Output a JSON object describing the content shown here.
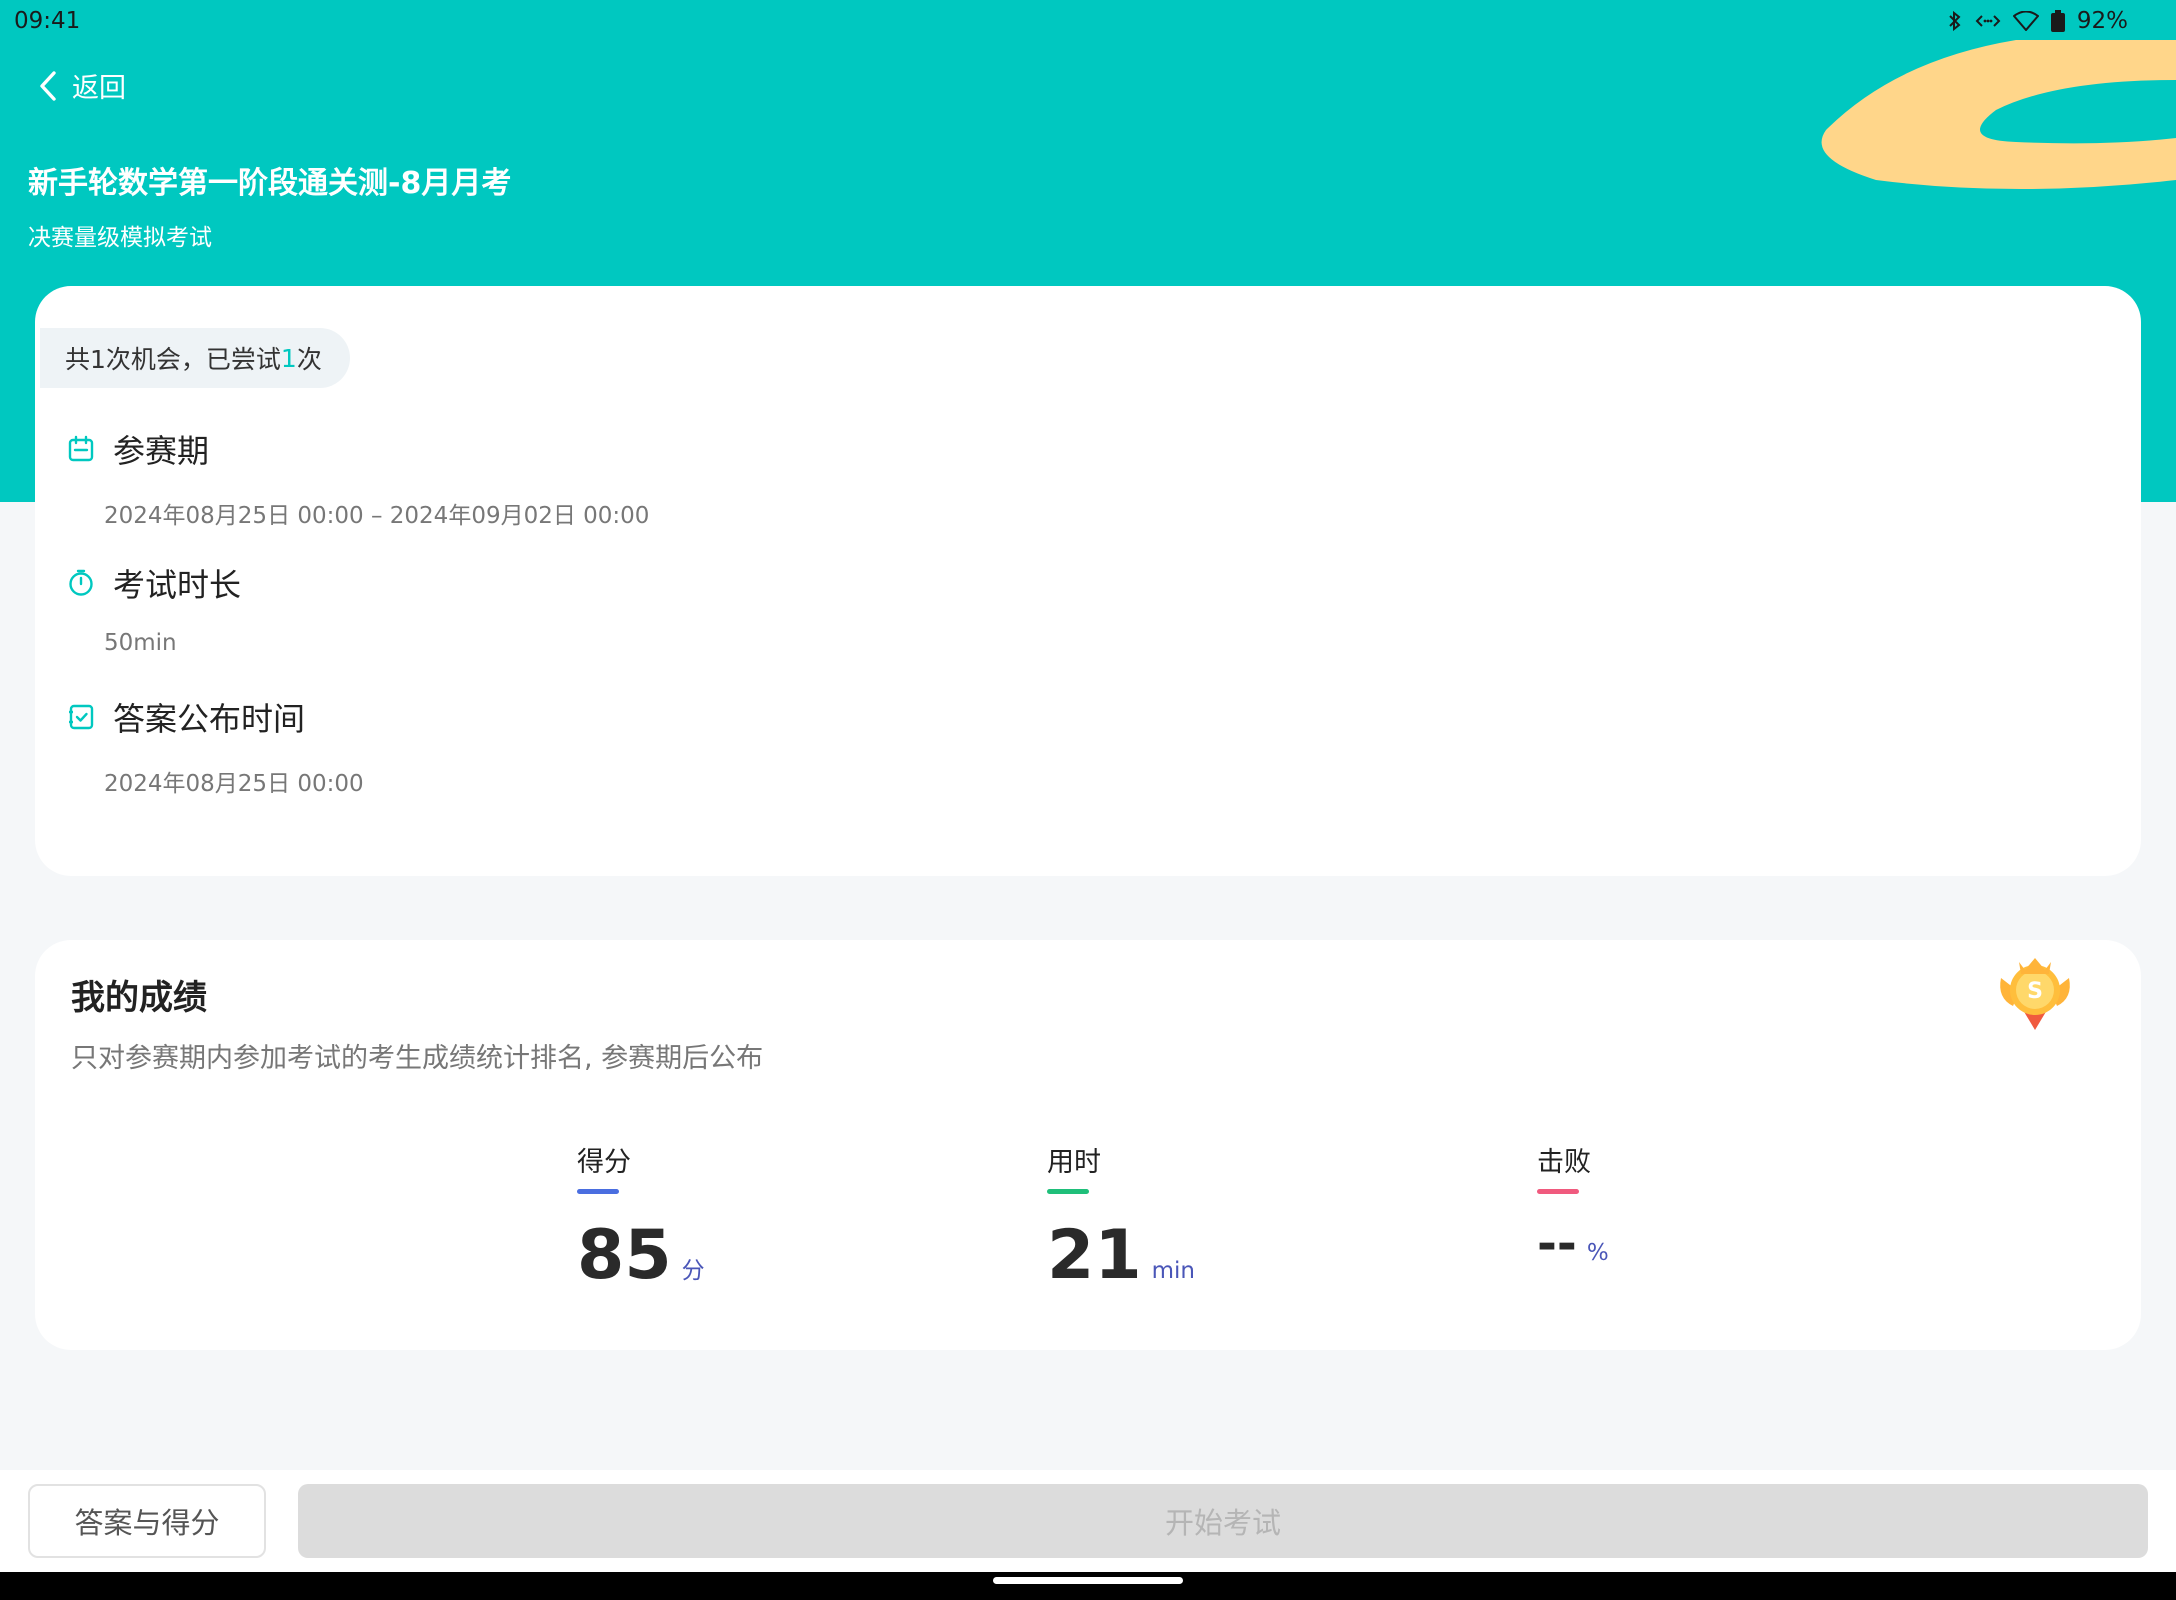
{
  "status_bar": {
    "time": "09:41",
    "battery": "92%"
  },
  "header": {
    "back_label": "返回",
    "title": "新手轮数学第一阶段通关测-8月月考",
    "subtitle": "决赛量级模拟考试"
  },
  "info": {
    "attempt_prefix": "共1次机会，已尝试",
    "attempt_count": "1",
    "attempt_suffix": "次",
    "period_label": "参赛期",
    "period_value": "2024年08月25日 00:00 – 2024年09月02日 00:00",
    "duration_label": "考试时长",
    "duration_value": "50min",
    "answer_label": "答案公布时间",
    "answer_value": "2024年08月25日 00:00"
  },
  "score": {
    "title": "我的成绩",
    "description": "只对参赛期内参加考试的考生成绩统计排名, 参赛期后公布",
    "stats": [
      {
        "label": "得分",
        "value": "85",
        "unit": "分",
        "color": "#4a6ee0"
      },
      {
        "label": "用时",
        "value": "21",
        "unit": "min",
        "color": "#1fbf7a"
      },
      {
        "label": "击败",
        "value": "--",
        "unit": "%",
        "color": "#f05a7e"
      }
    ]
  },
  "bottom": {
    "answers_button": "答案与得分",
    "start_button": "开始考试"
  },
  "colors": {
    "primary": "#00c8c0",
    "accent_yellow": "#ffd68a"
  },
  "icons": {
    "back": "chevron-left-icon",
    "period": "calendar-icon",
    "duration": "stopwatch-icon",
    "answer": "checklist-icon",
    "medal": "medal-icon"
  }
}
